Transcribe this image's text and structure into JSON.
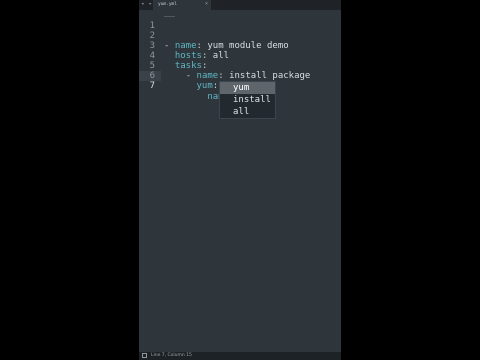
{
  "tab": {
    "filename": "yum.yml",
    "close": "×"
  },
  "nav": {
    "arrows": "◂ ▸"
  },
  "editor": {
    "lines": [
      {
        "num": "1",
        "indent": "",
        "dash": "",
        "key": "",
        "colon": "",
        "value": ""
      },
      {
        "num": "2",
        "indent": "",
        "dash": "- ",
        "key": "name",
        "colon": ": ",
        "value": "yum module demo"
      },
      {
        "num": "3",
        "indent": "  ",
        "dash": "",
        "key": "hosts",
        "colon": ": ",
        "value": "all"
      },
      {
        "num": "4",
        "indent": "  ",
        "dash": "",
        "key": "tasks",
        "colon": ":",
        "value": ""
      },
      {
        "num": "5",
        "indent": "    ",
        "dash": "- ",
        "key": "name",
        "colon": ": ",
        "value": "install package"
      },
      {
        "num": "6",
        "indent": "      ",
        "dash": "",
        "key": "yum",
        "colon": ":",
        "value": ""
      },
      {
        "num": "7",
        "indent": "        ",
        "dash": "",
        "key": "name",
        "colon": ": ",
        "value": ""
      }
    ],
    "active_line": "7"
  },
  "autocomplete": {
    "items": [
      "yum",
      "install",
      "all"
    ],
    "selected_index": 0
  },
  "status": {
    "text": "Line 7, Column 15"
  }
}
